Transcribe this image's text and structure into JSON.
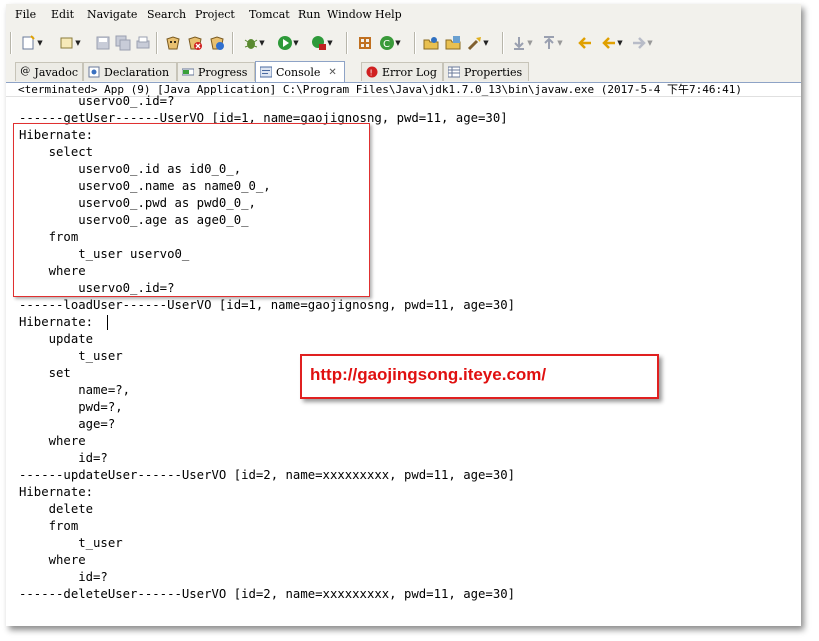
{
  "menu": [
    "File",
    "Edit",
    "Navigate",
    "Search",
    "Project",
    "Tomcat",
    "Run",
    "Window",
    "Help"
  ],
  "tabs": [
    {
      "label": "Javadoc",
      "icon": "at-icon"
    },
    {
      "label": "Declaration",
      "icon": "declaration-icon"
    },
    {
      "label": "Progress",
      "icon": "progress-icon"
    },
    {
      "label": "Console",
      "icon": "console-icon",
      "active": true
    },
    {
      "label": "Error Log",
      "icon": "error-log-icon"
    },
    {
      "label": "Properties",
      "icon": "properties-icon"
    }
  ],
  "status": "<terminated> App (9) [Java Application] C:\\Program Files\\Java\\jdk1.7.0_13\\bin\\javaw.exe (2017-5-4 下午7:46:41)",
  "console_lines": [
    "        uservo0_.id=?",
    "------getUser------UserVO [id=1, name=gaojignosng, pwd=11, age=30]",
    "Hibernate: ",
    "    select",
    "        uservo0_.id as id0_0_,",
    "        uservo0_.name as name0_0_,",
    "        uservo0_.pwd as pwd0_0_,",
    "        uservo0_.age as age0_0_",
    "    from",
    "        t_user uservo0_",
    "    where",
    "        uservo0_.id=?",
    "------loadUser------UserVO [id=1, name=gaojignosng, pwd=11, age=30]",
    "Hibernate: ",
    "    update",
    "        t_user ",
    "    set",
    "        name=?,",
    "        pwd=?,",
    "        age=?",
    "    where",
    "        id=?",
    "------updateUser------UserVO [id=2, name=xxxxxxxxx, pwd=11, age=30]",
    "Hibernate: ",
    "    delete",
    "    from",
    "        t_user ",
    "    where",
    "        id=?",
    "------deleteUser------UserVO [id=2, name=xxxxxxxxx, pwd=11, age=30]"
  ],
  "watermark": "http://gaojingsong.iteye.com/",
  "colors": {
    "highlight_border": "#e03030",
    "watermark": "#e01010"
  }
}
